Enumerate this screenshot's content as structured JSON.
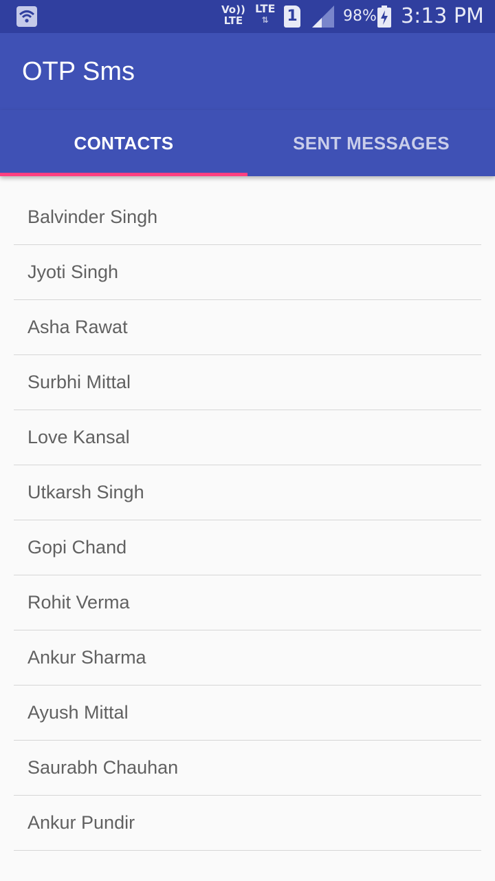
{
  "status_bar": {
    "volte_line1": "Vo))",
    "volte_line2": "LTE",
    "network": "LTE",
    "network_arrows": "⇅",
    "sim_slot": "1",
    "battery_percent": "98%",
    "time": "3:13 PM",
    "icons": [
      "wifi-icon",
      "signal-icon",
      "battery-charging-icon"
    ]
  },
  "app_bar": {
    "title": "OTP Sms"
  },
  "tabs": [
    {
      "label": "CONTACTS",
      "active": true
    },
    {
      "label": "SENT MESSAGES",
      "active": false
    }
  ],
  "contacts": [
    "Balvinder Singh",
    "Jyoti Singh",
    "Asha Rawat",
    "Surbhi Mittal",
    "Love Kansal",
    "Utkarsh Singh",
    "Gopi Chand",
    "Rohit Verma",
    "Ankur Sharma",
    "Ayush Mittal",
    "Saurabh Chauhan",
    "Ankur Pundir"
  ],
  "colors": {
    "status_bar": "#303f9f",
    "primary": "#3f51b5",
    "accent": "#ff4081",
    "background": "#fafafa",
    "list_text": "#616161",
    "divider": "#d6d6d6"
  }
}
